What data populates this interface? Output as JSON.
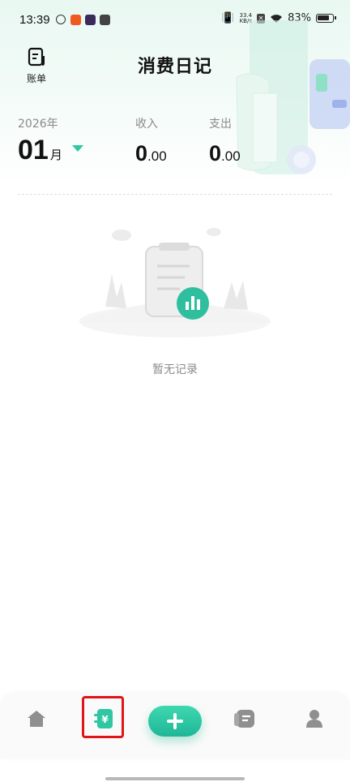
{
  "status_bar": {
    "time": "13:39",
    "net_speed_value": "33.4",
    "net_speed_unit": "KB/s",
    "battery_percent": "83%"
  },
  "header": {
    "title": "消费日记",
    "bills_label": "账单"
  },
  "summary": {
    "year": "2026年",
    "month": "01",
    "month_unit": "月",
    "income_label": "收入",
    "income_int": "0",
    "income_dec": ".00",
    "expense_label": "支出",
    "expense_int": "0",
    "expense_dec": ".00"
  },
  "empty_state": {
    "message": "暂无记录"
  },
  "tabbar": {
    "items": [
      {
        "icon": "home-icon",
        "active": false
      },
      {
        "icon": "ledger-yen-icon",
        "active": true
      },
      {
        "icon": "add-icon",
        "active": false
      },
      {
        "icon": "notes-icon",
        "active": false
      },
      {
        "icon": "profile-icon",
        "active": false
      }
    ]
  },
  "colors": {
    "accent": "#2fc7a3",
    "highlight_box": "#e0141a"
  }
}
